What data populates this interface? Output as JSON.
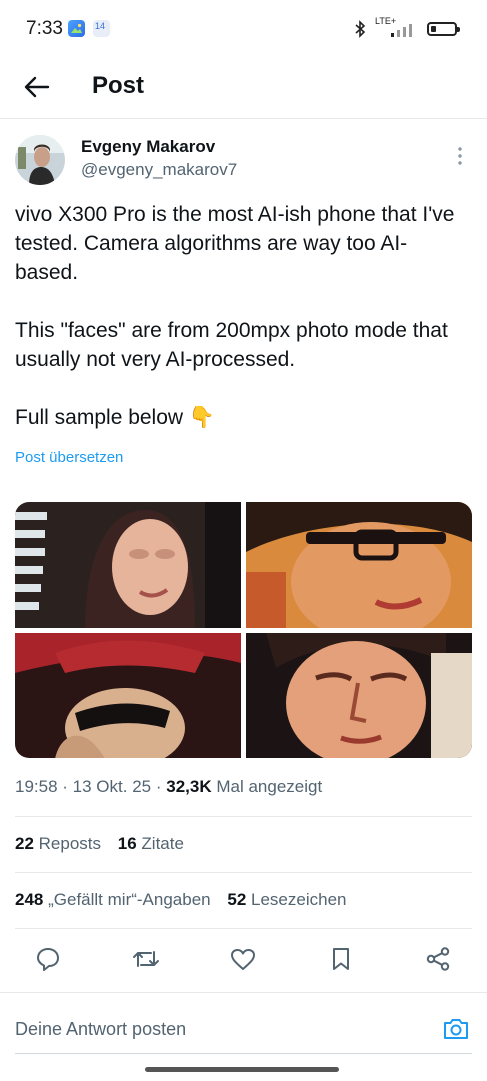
{
  "status_bar": {
    "time": "7:33",
    "notification_badge": "14",
    "network": "LTE+"
  },
  "header": {
    "title": "Post"
  },
  "author": {
    "display_name": "Evgeny Makarov",
    "handle": "@evgeny_makarov7"
  },
  "tweet": {
    "paragraphs": [
      "vivo X300 Pro is the most AI-ish phone that I've tested. Camera algorithms are way too AI-based.",
      "This \"faces\" are from 200mpx photo mode that usually not very AI-processed.",
      "Full sample below 👇"
    ],
    "translate_label": "Post übersetzen"
  },
  "media": {
    "count": 4
  },
  "meta": {
    "time": "19:58",
    "date": "13 Okt. 25",
    "views_count": "32,3K",
    "views_label": "Mal angezeigt"
  },
  "stats": {
    "reposts_count": "22",
    "reposts_label": "Reposts",
    "quotes_count": "16",
    "quotes_label": "Zitate",
    "likes_count": "248",
    "likes_label": "„Gefällt mir“-Angaben",
    "bookmarks_count": "52",
    "bookmarks_label": "Lesezeichen"
  },
  "actions": [
    "reply-icon",
    "repost-icon",
    "like-icon",
    "bookmark-icon",
    "share-icon"
  ],
  "reply": {
    "placeholder": "Deine Antwort posten"
  },
  "colors": {
    "accent": "#1d9bf0",
    "text_primary": "#0f1419",
    "text_secondary": "#536471",
    "divider": "#e6e9eb"
  }
}
